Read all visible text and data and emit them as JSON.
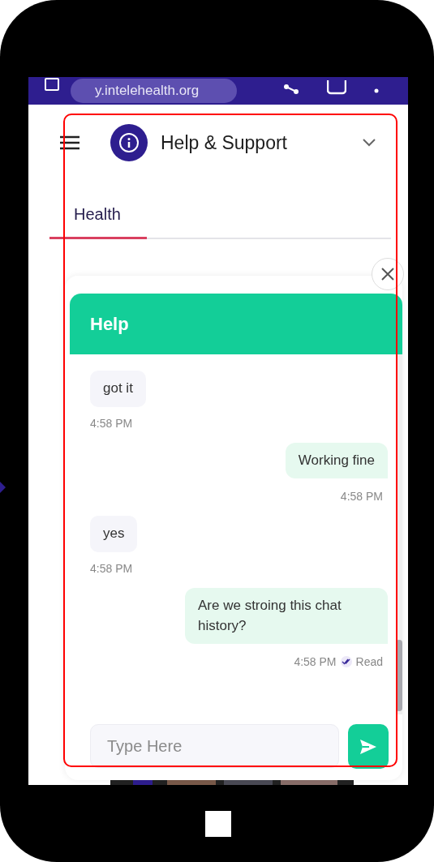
{
  "browser": {
    "url": "y.intelehealth.org"
  },
  "header": {
    "title": "Help & Support"
  },
  "tabs": [
    {
      "label": "Health",
      "selected": true
    }
  ],
  "chat": {
    "title": "Help",
    "messages": [
      {
        "kind": "received",
        "text": "got it",
        "time": "4:58 PM"
      },
      {
        "kind": "sent",
        "text": "Working fine",
        "time": "4:58 PM"
      },
      {
        "kind": "received",
        "text": "yes",
        "time": "4:58 PM"
      },
      {
        "kind": "sent",
        "text": "Are we stroing this chat history?",
        "time": "4:58 PM",
        "status": "Read"
      }
    ],
    "input": {
      "placeholder": "Type Here"
    }
  }
}
